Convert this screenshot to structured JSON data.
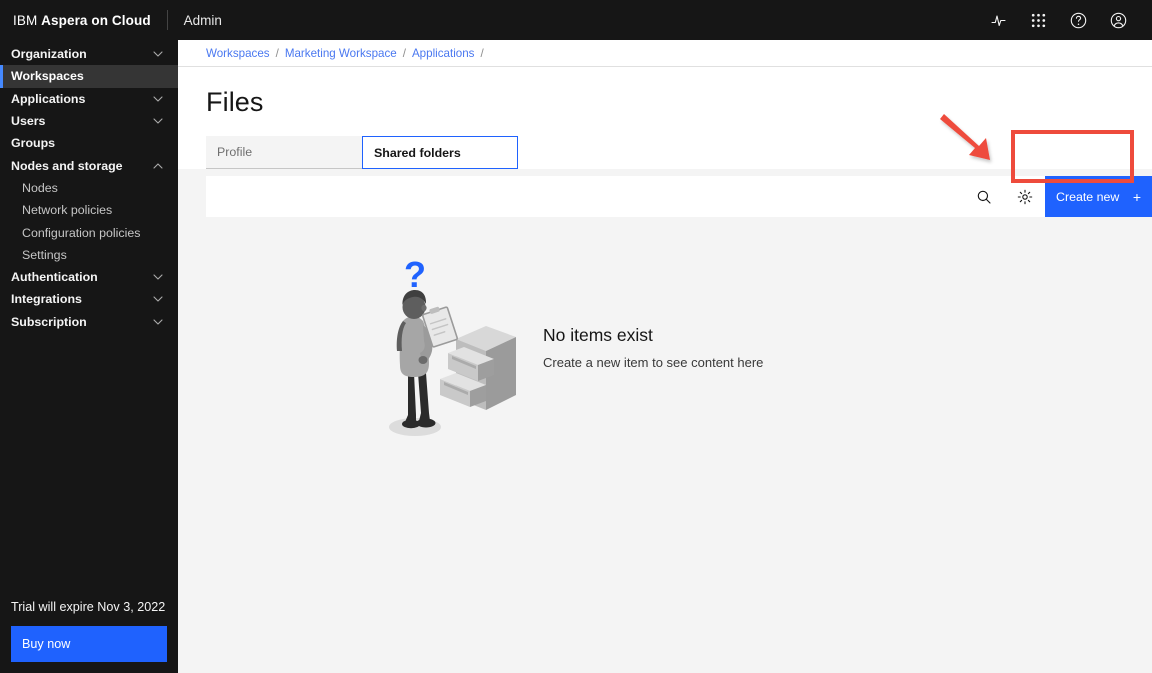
{
  "header": {
    "brand_prefix": "IBM ",
    "brand_name": "Aspera on Cloud",
    "admin_label": "Admin",
    "icons": [
      {
        "name": "activity-icon"
      },
      {
        "name": "app-switcher-icon"
      },
      {
        "name": "help-icon"
      },
      {
        "name": "user-avatar-icon"
      }
    ]
  },
  "sidebar": {
    "items": [
      {
        "label": "Organization",
        "chevron": "down",
        "active": false,
        "sub": false
      },
      {
        "label": "Workspaces",
        "chevron": "none",
        "active": true,
        "sub": false
      },
      {
        "label": "Applications",
        "chevron": "down",
        "active": false,
        "sub": false
      },
      {
        "label": "Users",
        "chevron": "down",
        "active": false,
        "sub": false
      },
      {
        "label": "Groups",
        "chevron": "none",
        "active": false,
        "sub": false
      },
      {
        "label": "Nodes and storage",
        "chevron": "up",
        "active": false,
        "sub": false
      },
      {
        "label": "Nodes",
        "chevron": "none",
        "active": false,
        "sub": true
      },
      {
        "label": "Network policies",
        "chevron": "none",
        "active": false,
        "sub": true
      },
      {
        "label": "Configuration policies",
        "chevron": "none",
        "active": false,
        "sub": true
      },
      {
        "label": "Settings",
        "chevron": "none",
        "active": false,
        "sub": true
      },
      {
        "label": "Authentication",
        "chevron": "down",
        "active": false,
        "sub": false
      },
      {
        "label": "Integrations",
        "chevron": "down",
        "active": false,
        "sub": false
      },
      {
        "label": "Subscription",
        "chevron": "down",
        "active": false,
        "sub": false
      }
    ],
    "trial_text": "Trial will expire Nov 3, 2022",
    "buy_label": "Buy now"
  },
  "breadcrumb": {
    "items": [
      "Workspaces",
      "Marketing Workspace",
      "Applications"
    ],
    "separator": "/",
    "trailing_separator": "/"
  },
  "page": {
    "title": "Files"
  },
  "tabs": [
    {
      "label": "Profile",
      "active": false
    },
    {
      "label": "Shared folders",
      "active": true
    }
  ],
  "toolbar": {
    "search_icon": "search-icon",
    "settings_icon": "gear-icon",
    "create_label": "Create new",
    "create_plus": "+"
  },
  "empty_state": {
    "title": "No items exist",
    "subtitle": "Create a new item to see content here",
    "illustration": "person-with-filing-cabinet-illustration",
    "question_mark": "?"
  },
  "annotation": {
    "arrow": "red-pointer-arrow",
    "box": "red-highlight-box"
  },
  "colors": {
    "header_bg": "#161616",
    "sidebar_bg": "#161616",
    "sidebar_active_bg": "#353535",
    "accent_blue": "#1f62fe",
    "link_blue": "#4a78f0",
    "annotation_red": "#ee4b3c",
    "content_bg": "#f4f4f4"
  }
}
